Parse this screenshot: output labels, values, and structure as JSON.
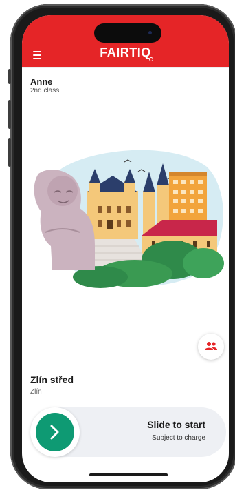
{
  "app": {
    "brand": "FAIRTIQ"
  },
  "user": {
    "name": "Anne",
    "travel_class": "2nd class"
  },
  "station": {
    "name": "Zlín střed",
    "city": "Zlín"
  },
  "slider": {
    "title": "Slide to start",
    "subtitle": "Subject to charge"
  },
  "colors": {
    "brand_red": "#e52527",
    "accent_green": "#0e9a73",
    "slider_bg": "#eef0f4"
  },
  "icons": {
    "menu": "menu-icon",
    "group": "group-icon",
    "arrow": "chevron-right-icon"
  }
}
